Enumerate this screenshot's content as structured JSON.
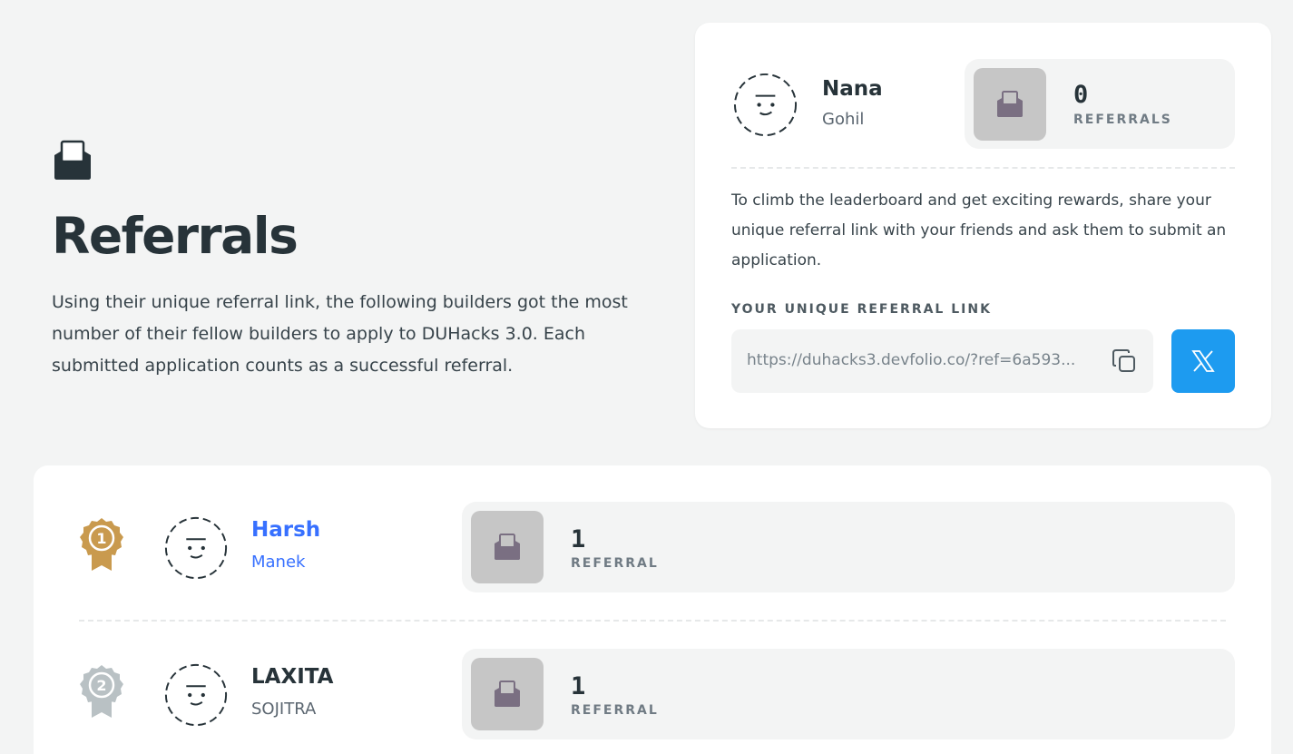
{
  "hero": {
    "icon": "envelope-open-icon",
    "title": "Referrals",
    "description": "Using their unique referral link, the following builders got the most number of their fellow builders to apply to DUHacks 3.0. Each submitted application counts as a successful referral."
  },
  "user": {
    "first_name": "Nana",
    "last_name": "Gohil",
    "referral_count": "0",
    "referral_label": "REFERRALS",
    "description": "To climb the leaderboard and get exciting rewards, share your unique referral link with your friends and ask them to submit an application.",
    "link_label": "YOUR UNIQUE REFERRAL LINK",
    "link_value": "https://duhacks3.devfolio.co/?ref=6a593..."
  },
  "leaderboard": [
    {
      "rank": "1",
      "first_name": "Harsh",
      "last_name": "Manek",
      "count": "1",
      "label": "REFERRAL",
      "medal": "gold"
    },
    {
      "rank": "2",
      "first_name": "LAXITA",
      "last_name": "SOJITRA",
      "count": "1",
      "label": "REFERRAL",
      "medal": "silver"
    }
  ],
  "colors": {
    "background": "#f3f4f4",
    "accent_link": "#3770ff",
    "twitter_button": "#1d9bf0",
    "gold_medal": "#c99a4e",
    "silver_medal": "#b9c1c4",
    "icon_box": "#c6c6c6"
  }
}
